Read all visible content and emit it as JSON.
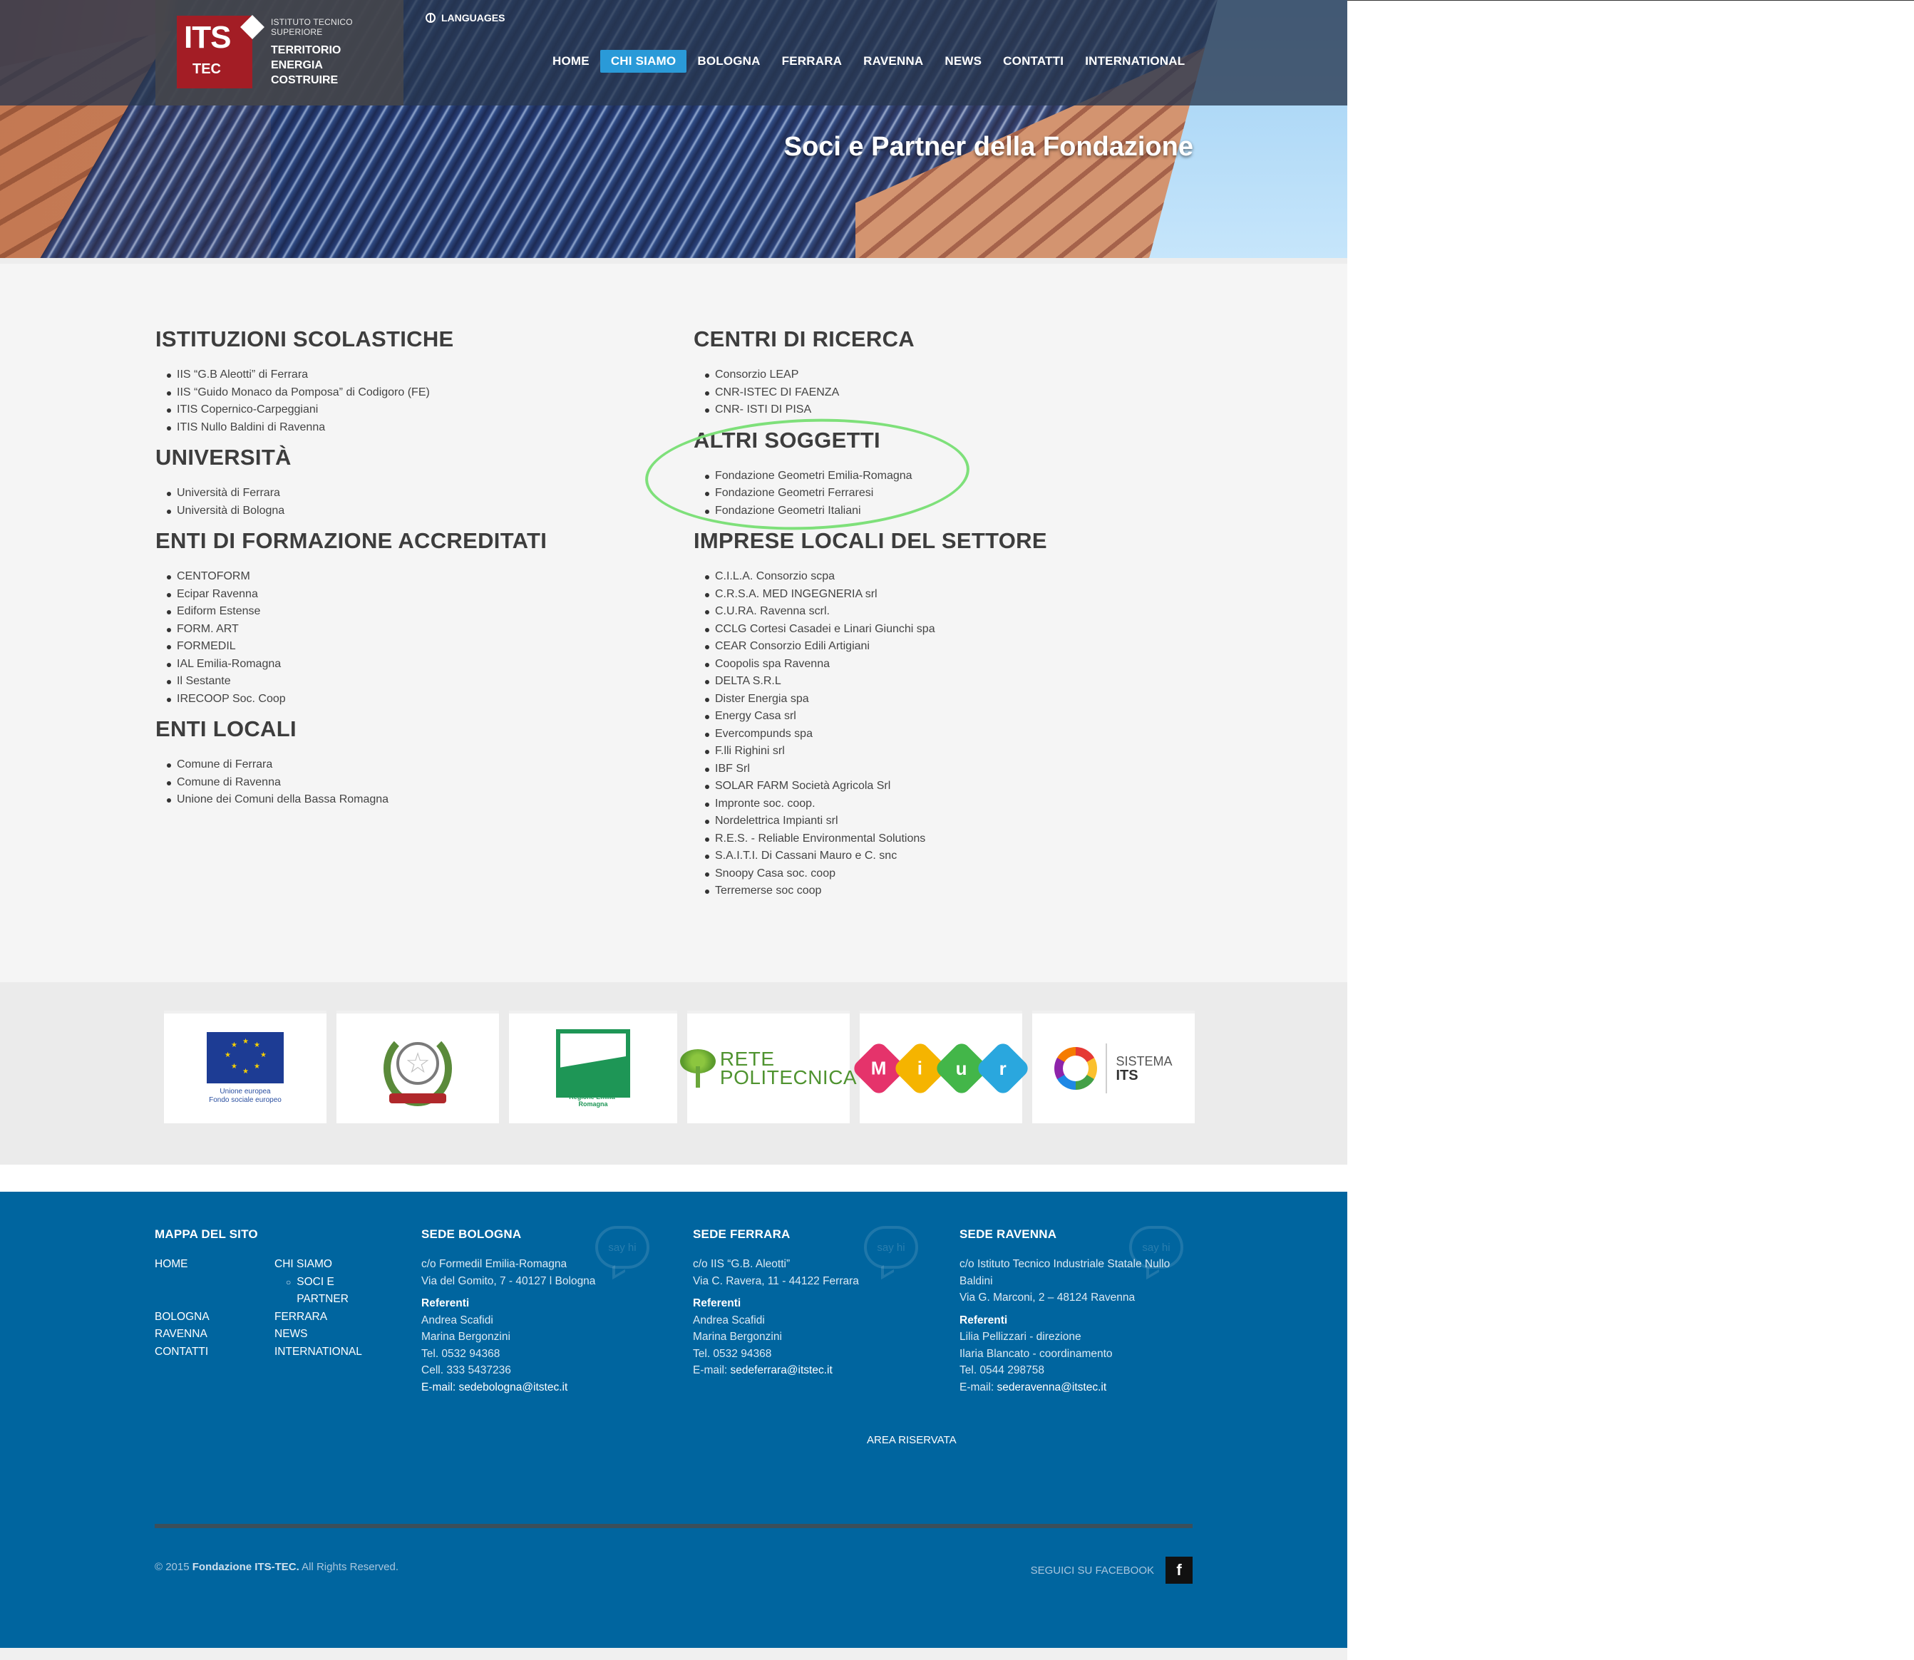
{
  "header": {
    "logo": {
      "its": "ITS",
      "tec": "TEC",
      "tagline": "ISTITUTO TECNICO SUPERIORE",
      "lines": [
        "TERRITORIO",
        "ENERGIA",
        "COSTRUIRE"
      ]
    },
    "languages_label": "LANGUAGES",
    "nav": [
      {
        "label": "HOME",
        "active": false
      },
      {
        "label": "CHI SIAMO",
        "active": true
      },
      {
        "label": "BOLOGNA",
        "active": false
      },
      {
        "label": "FERRARA",
        "active": false
      },
      {
        "label": "RAVENNA",
        "active": false
      },
      {
        "label": "NEWS",
        "active": false
      },
      {
        "label": "CONTATTI",
        "active": false
      },
      {
        "label": "INTERNATIONAL",
        "active": false
      }
    ],
    "hero_title": "Soci e Partner della Fondazione"
  },
  "sections": {
    "istituzioni": {
      "title": "ISTITUZIONI SCOLASTICHE",
      "items": [
        "IIS “G.B Aleotti” di Ferrara",
        "IIS “Guido Monaco da Pomposa” di Codigoro (FE)",
        "ITIS Copernico-Carpeggiani",
        "ITIS Nullo Baldini di Ravenna"
      ]
    },
    "universita": {
      "title": "UNIVERSITÀ",
      "items": [
        "Università di Ferrara",
        "Università di Bologna"
      ]
    },
    "enti_formazione": {
      "title": "ENTI DI FORMAZIONE ACCREDITATI",
      "items": [
        "CENTOFORM",
        "Ecipar Ravenna",
        "Ediform Estense",
        "FORM. ART",
        "FORMEDIL",
        "IAL Emilia-Romagna",
        "Il Sestante",
        "IRECOOP Soc. Coop"
      ]
    },
    "enti_locali": {
      "title": "ENTI LOCALI",
      "items": [
        "Comune di Ferrara",
        "Comune di Ravenna",
        "Unione dei Comuni della Bassa Romagna"
      ]
    },
    "centri_ricerca": {
      "title": "CENTRI DI RICERCA",
      "items": [
        "Consorzio LEAP",
        "CNR-ISTEC DI FAENZA",
        "CNR- ISTI DI PISA"
      ]
    },
    "altri_soggetti": {
      "title": "ALTRI SOGGETTI",
      "items": [
        "Fondazione Geometri Emilia-Romagna",
        "Fondazione Geometri Ferraresi",
        "Fondazione Geometri Italiani"
      ]
    },
    "imprese": {
      "title": "IMPRESE LOCALI DEL SETTORE",
      "items": [
        "C.I.L.A. Consorzio scpa",
        "C.R.S.A. MED INGEGNERIA srl",
        "C.U.RA. Ravenna scrl.",
        "CCLG Cortesi Casadei e Linari Giunchi spa",
        "CEAR Consorzio Edili Artigiani",
        "Coopolis spa Ravenna",
        "DELTA S.R.L",
        "Dister Energia spa",
        "Energy Casa srl",
        "Evercompunds spa",
        "F.lli Righini srl",
        "IBF Srl",
        "SOLAR FARM Società Agricola Srl",
        "Impronte soc. coop.",
        "Nordelettrica Impianti srl",
        "R.E.S. - Reliable Environmental Solutions",
        "S.A.I.T.I. Di Cassani Mauro e C. snc",
        "Snoopy Casa soc. coop",
        "Terremerse soc coop"
      ]
    }
  },
  "partner_logos": {
    "eu_caption_1": "Unione europea",
    "eu_caption_2": "Fondo sociale europeo",
    "emblem_ribbon": "REPUBBLICA ITALIANA",
    "rer_caption": "Regione Emilia-Romagna",
    "rete_1": "RETE",
    "rete_2": "POLITECNICA",
    "miur": [
      "M",
      "i",
      "u",
      "r"
    ],
    "miur_colors": [
      "#e5336b",
      "#f5b400",
      "#43b649",
      "#2aa7de"
    ],
    "sistema_1": "SISTEMA",
    "sistema_2": "ITS"
  },
  "footer": {
    "mappa": {
      "title": "MAPPA DEL SITO",
      "col1": [
        "HOME",
        "BOLOGNA",
        "RAVENNA",
        "CONTATTI"
      ],
      "col2_top": "CHI SIAMO",
      "col2_sub": "SOCI E PARTNER",
      "col2_rest": [
        "FERRARA",
        "NEWS",
        "INTERNATIONAL"
      ]
    },
    "bologna": {
      "title": "SEDE BOLOGNA",
      "address_1": "c/o Formedil Emilia-Romagna",
      "address_2": "Via del Gomito, 7 - 40127 l Bologna",
      "ref_label": "Referenti",
      "people": [
        "Andrea Scafidi",
        "Marina Bergonzini"
      ],
      "tel": "Tel. 0532 94368",
      "cell": "Cell. 333 5437236",
      "email_label": "E-mail:",
      "email": "sedebologna@itstec.it"
    },
    "ferrara": {
      "title": "SEDE FERRARA",
      "address_1": "c/o IIS “G.B. Aleotti”",
      "address_2": "Via C. Ravera, 11 - 44122 Ferrara",
      "ref_label": "Referenti",
      "people": [
        "Andrea Scafidi",
        "Marina Bergonzini"
      ],
      "tel": "Tel. 0532 94368",
      "email_label": "E-mail:",
      "email": "sedeferrara@itstec.it"
    },
    "ravenna": {
      "title": "SEDE RAVENNA",
      "address_1": "c/o Istituto Tecnico Industriale Statale Nullo Baldini",
      "address_2": "Via G. Marconi, 2 – 48124 Ravenna",
      "ref_label": "Referenti",
      "people": [
        "Lilia Pellizzari - direzione",
        "Ilaria Blancato - coordinamento"
      ],
      "tel": "Tel. 0544 298758",
      "email_label": "E-mail:",
      "email": "sederavenna@itstec.it"
    },
    "sayhi": "say hi",
    "area_riservata": "AREA RISERVATA",
    "copyright_prefix": "© 2015",
    "copyright_brand": "Fondazione ITS-TEC.",
    "copyright_suffix": "All Rights Reserved.",
    "social_label": "SEGUICI SU FACEBOOK",
    "fb_glyph": "f"
  },
  "colors": {
    "accent": "#2a9ad8",
    "footer_bg": "#00659f",
    "logo_red": "#a31d25",
    "highlight": "#7ee07a"
  }
}
